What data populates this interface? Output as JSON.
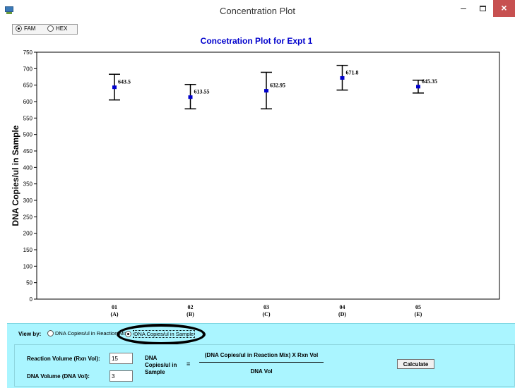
{
  "window": {
    "title": "Concentration Plot",
    "controls": {
      "minimize": "–",
      "close": "×"
    }
  },
  "channels": {
    "options": [
      "FAM",
      "HEX"
    ],
    "selected": "FAM"
  },
  "chart_data": {
    "type": "scatter",
    "title": "Concetration Plot for Expt 1",
    "ylabel": "DNA Copies/ul in Sample",
    "xlabel": "",
    "ylim": [
      0,
      750
    ],
    "yticks": [
      0,
      50,
      100,
      150,
      200,
      250,
      300,
      350,
      400,
      450,
      500,
      550,
      600,
      650,
      700,
      750
    ],
    "categories": [
      {
        "well": "01",
        "group": "(A)"
      },
      {
        "well": "02",
        "group": "(B)"
      },
      {
        "well": "03",
        "group": "(C)"
      },
      {
        "well": "04",
        "group": "(D)"
      },
      {
        "well": "05",
        "group": "(E)"
      }
    ],
    "series": [
      {
        "points": [
          {
            "value": 643.5,
            "label": "643.5",
            "err_low": 605,
            "err_high": 683
          },
          {
            "value": 613.55,
            "label": "613.55",
            "err_low": 578,
            "err_high": 652
          },
          {
            "value": 632.95,
            "label": "632.95",
            "err_low": 578,
            "err_high": 689
          },
          {
            "value": 671.8,
            "label": "671.8",
            "err_low": 635,
            "err_high": 710
          },
          {
            "value": 645.35,
            "label": "645.35",
            "err_low": 626,
            "err_high": 665
          }
        ],
        "marker_color": "#0000cc"
      }
    ],
    "grid": false,
    "legend": "none",
    "colors": {
      "title": "#0000cc",
      "error_bar": "#000000",
      "plot_border": "#000000"
    }
  },
  "view_by": {
    "label": "View by:",
    "options": [
      "DNA Copies/ul in Reaction Mix",
      "DNA Copies/ul in Sample"
    ],
    "selected": "DNA Copies/ul in Sample"
  },
  "form": {
    "reaction_volume_label": "Reaction Volume (Rxn Vol):",
    "reaction_volume_value": "15",
    "dna_volume_label": "DNA Volume (DNA Vol):",
    "dna_volume_value": "3",
    "formula_result_label": "DNA Copies/ul in Sample",
    "equals": "=",
    "numerator": "(DNA Copies/ul in Reaction Mix) X Rxn Vol",
    "denominator": "DNA Vol",
    "calculate_label": "Calculate"
  },
  "colors": {
    "panel_bg": "#aaf5ff",
    "close_button": "#c75050"
  }
}
